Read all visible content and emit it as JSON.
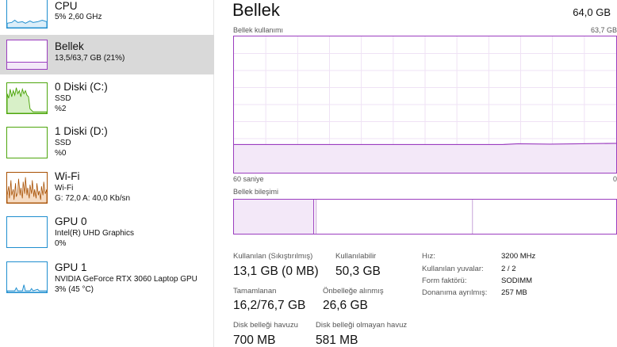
{
  "sidebar": {
    "items": [
      {
        "title": "CPU",
        "lines": [
          "5%  2,60 GHz"
        ],
        "color": "#1f8ecf"
      },
      {
        "title": "Bellek",
        "lines": [
          "13,5/63,7 GB (21%)"
        ],
        "color": "#9b3dbf"
      },
      {
        "title": "0 Diski (C:)",
        "lines": [
          "SSD",
          "%2"
        ],
        "color": "#4da60c"
      },
      {
        "title": "1 Diski (D:)",
        "lines": [
          "SSD",
          "%0"
        ],
        "color": "#4da60c"
      },
      {
        "title": "Wi-Fi",
        "lines": [
          "Wi-Fi",
          "G: 72,0  A: 40,0 Kb/sn"
        ],
        "color": "#a74f01"
      },
      {
        "title": "GPU 0",
        "lines": [
          "Intel(R) UHD Graphics",
          "0%"
        ],
        "color": "#1f8ecf"
      },
      {
        "title": "GPU 1",
        "lines": [
          "NVIDIA GeForce RTX 3060 Laptop GPU",
          "3% (45 °C)"
        ],
        "color": "#1f8ecf"
      }
    ]
  },
  "main": {
    "title": "Bellek",
    "total": "64,0 GB",
    "usage_label": "Bellek kullanımı",
    "usage_max": "63,7 GB",
    "time_left": "60 saniye",
    "time_right": "0",
    "composition_label": "Bellek bileşimi",
    "accent": "#9b3dbf",
    "stats": {
      "in_use_label": "Kullanılan (Sıkıştırılmış)",
      "in_use_value": "13,1 GB (0 MB)",
      "available_label": "Kullanılabilir",
      "available_value": "50,3 GB",
      "committed_label": "Tamamlanan",
      "committed_value": "16,2/76,7 GB",
      "cached_label": "Önbelleğe alınmış",
      "cached_value": "26,6 GB",
      "paged_label": "Disk belleği havuzu",
      "paged_value": "700 MB",
      "nonpaged_label": "Disk belleği olmayan havuz",
      "nonpaged_value": "581 MB"
    },
    "details": [
      {
        "label": "Hız:",
        "value": "3200 MHz"
      },
      {
        "label": "Kullanılan yuvalar:",
        "value": "2 / 2"
      },
      {
        "label": "Form faktörü:",
        "value": "SODIMM"
      },
      {
        "label": "Donanıma ayrılmış:",
        "value": "257 MB"
      }
    ]
  }
}
